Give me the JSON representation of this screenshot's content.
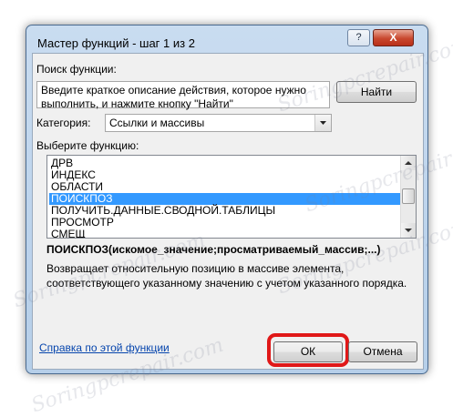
{
  "dialog": {
    "title": "Мастер функций - шаг 1 из 2",
    "help_button": "?",
    "close_button": "X"
  },
  "search": {
    "label": "Поиск функции:",
    "description_text_line1": "Введите краткое описание действия, которое нужно",
    "description_text_line2": "выполнить, и нажмите кнопку \"Найти\"",
    "find_button": "Найти"
  },
  "category": {
    "label": "Категория:",
    "selected": "Ссылки и массивы"
  },
  "function_list": {
    "label": "Выберите функцию:",
    "items": [
      {
        "label": "ДРВ",
        "selected": false
      },
      {
        "label": "ИНДЕКС",
        "selected": false
      },
      {
        "label": "ОБЛАСТИ",
        "selected": false
      },
      {
        "label": "ПОИСКПОЗ",
        "selected": true
      },
      {
        "label": "ПОЛУЧИТЬ.ДАННЫЕ.СВОДНОЙ.ТАБЛИЦЫ",
        "selected": false
      },
      {
        "label": "ПРОСМОТР",
        "selected": false
      },
      {
        "label": "СМЕЩ",
        "selected": false
      }
    ]
  },
  "details": {
    "signature": "ПОИСКПОЗ(искомое_значение;просматриваемый_массив;...)",
    "description_line1": "Возвращает относительную позицию в массиве элемента,",
    "description_line2": "соответствующего указанному значению с учетом указанного порядка."
  },
  "footer": {
    "help_link": "Справка по этой функции",
    "ok_button": "ОК",
    "cancel_button": "Отмена"
  },
  "colors": {
    "selection": "#3399ff",
    "highlight_ring": "#e01818",
    "link": "#0645ad"
  },
  "watermark": "Soringpcrepair.com"
}
